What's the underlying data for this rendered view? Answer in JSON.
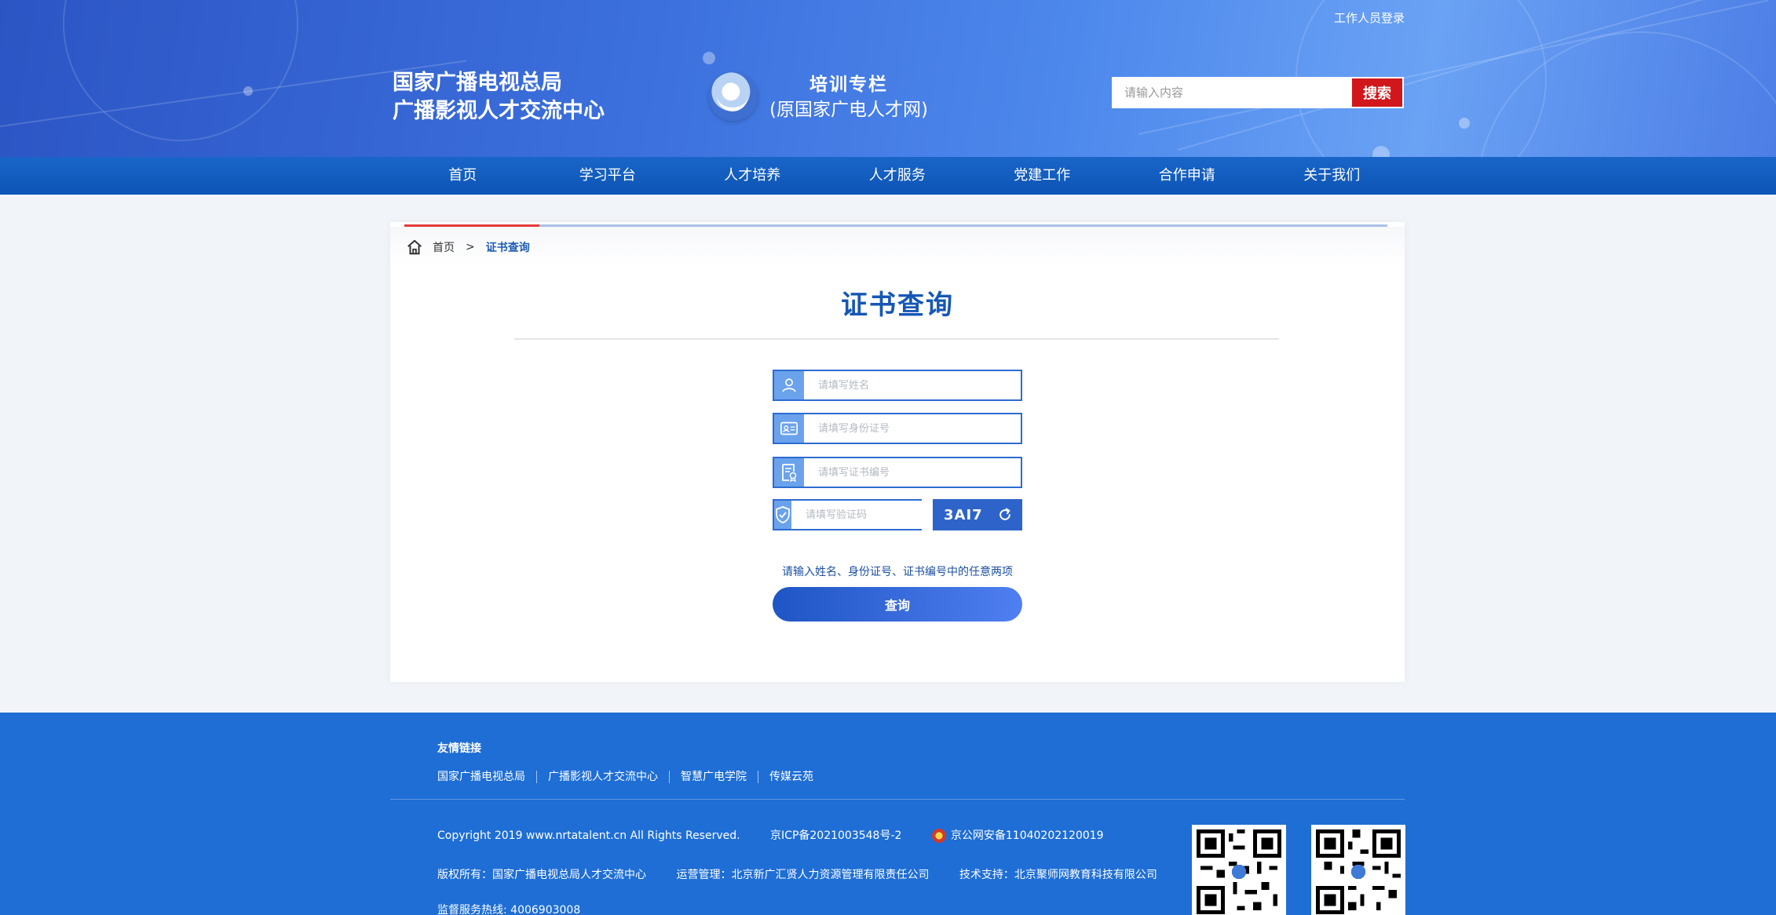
{
  "header": {
    "staff_login": "工作人员登录",
    "org_line1": "国家广播电视总局",
    "org_line2": "广播影视人才交流中心",
    "train_line1": "培训专栏",
    "train_line2": "(原国家广电人才网)",
    "search_placeholder": "请输入内容",
    "search_button": "搜索"
  },
  "nav": {
    "items": [
      "首页",
      "学习平台",
      "人才培养",
      "人才服务",
      "党建工作",
      "合作申请",
      "关于我们"
    ]
  },
  "breadcrumb": {
    "home": "首页",
    "separator": ">",
    "current": "证书查询"
  },
  "form": {
    "title": "证书查询",
    "name_placeholder": "请填写姓名",
    "id_placeholder": "请填写身份证号",
    "cert_placeholder": "请填写证书编号",
    "captcha_placeholder": "请填写验证码",
    "captcha_code": "3AI7",
    "hint": "请输入姓名、身份证号、证书编号中的任意两项",
    "submit": "查询"
  },
  "footer": {
    "friend_title": "友情链接",
    "friend_links": [
      "国家广播电视总局",
      "广播影视人才交流中心",
      "智慧广电学院",
      "传媒云苑"
    ],
    "copyright": "Copyright 2019 www.nrtatalent.cn All Rights Reserved.",
    "icp": "京ICP备2021003548号-2",
    "police": "京公网安备11040202120019",
    "owner": "版权所有：国家广播电视总局人才交流中心",
    "operator": "运营管理：北京新广汇贤人力资源管理有限责任公司",
    "tech": "技术支持：北京聚师网教育科技有限公司",
    "hotline": "监督服务热线: 4006903008"
  },
  "colors": {
    "primary": "#1657b5",
    "nav": "#1965c8",
    "footer": "#1e6ed6",
    "search_btn": "#d1171b",
    "accent_red": "#e43a3a"
  }
}
